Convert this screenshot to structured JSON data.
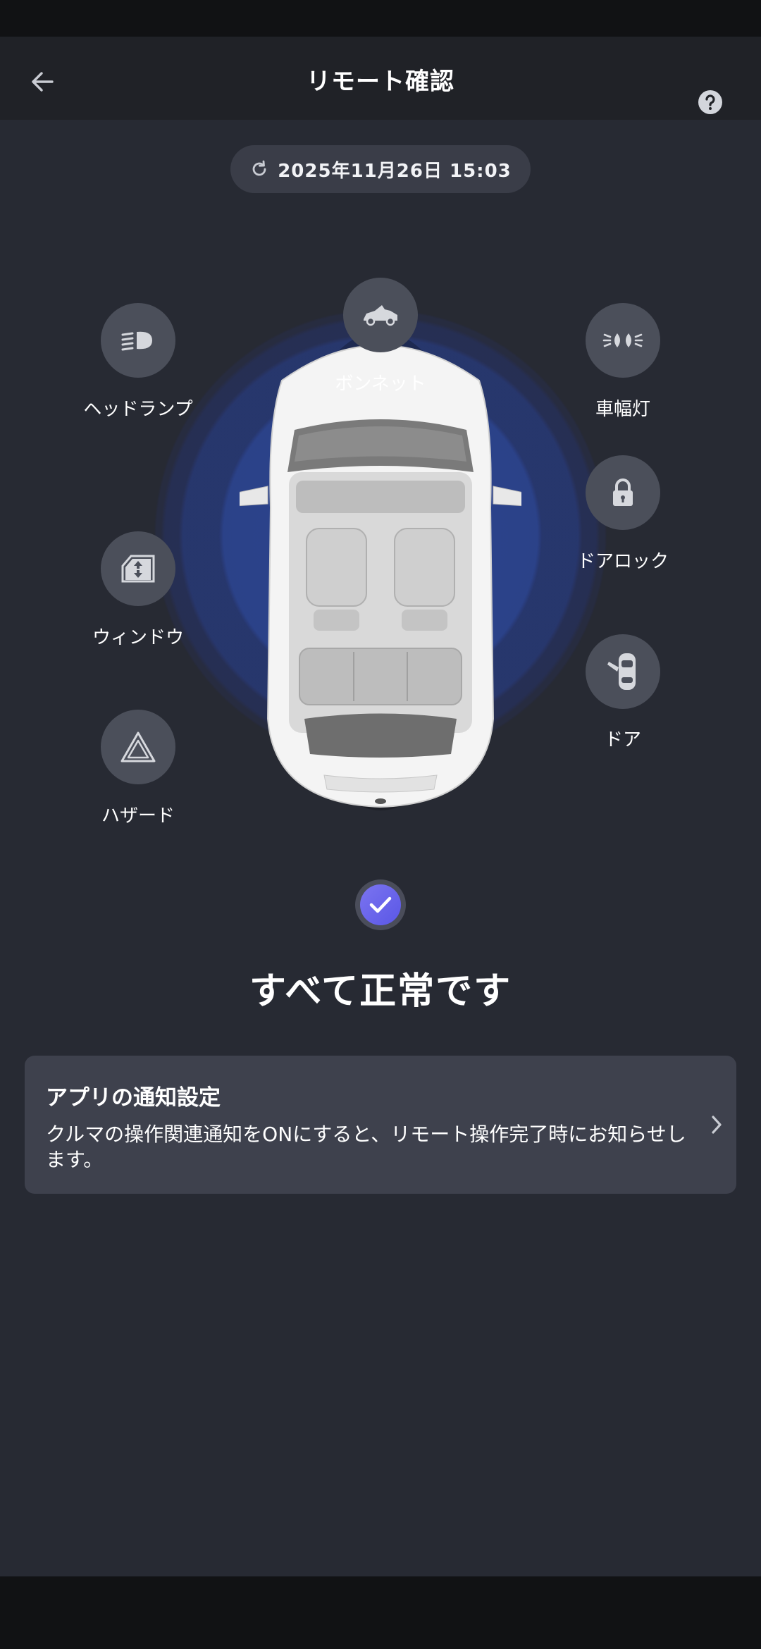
{
  "header": {
    "title": "リモート確認"
  },
  "timestamp": {
    "text": "2025年11月26日 15:03"
  },
  "vehicle_items": [
    {
      "label": "ボンネット"
    },
    {
      "label": "ヘッドランプ"
    },
    {
      "label": "車幅灯"
    },
    {
      "label": "ドアロック"
    },
    {
      "label": "ウィンドウ"
    },
    {
      "label": "ドア"
    },
    {
      "label": "ハザード"
    }
  ],
  "result": {
    "title": "すべて正常です"
  },
  "notice": {
    "title": "アプリの通知設定",
    "body": "クルマの操作関連通知をONにすると、リモート操作完了時にお知らせします。"
  },
  "colors": {
    "background": "#272a33",
    "app_bar": "#202227",
    "icon_circle": "#4b4f5a",
    "accent_check": "#6a66ec",
    "card": "#3e414d"
  }
}
